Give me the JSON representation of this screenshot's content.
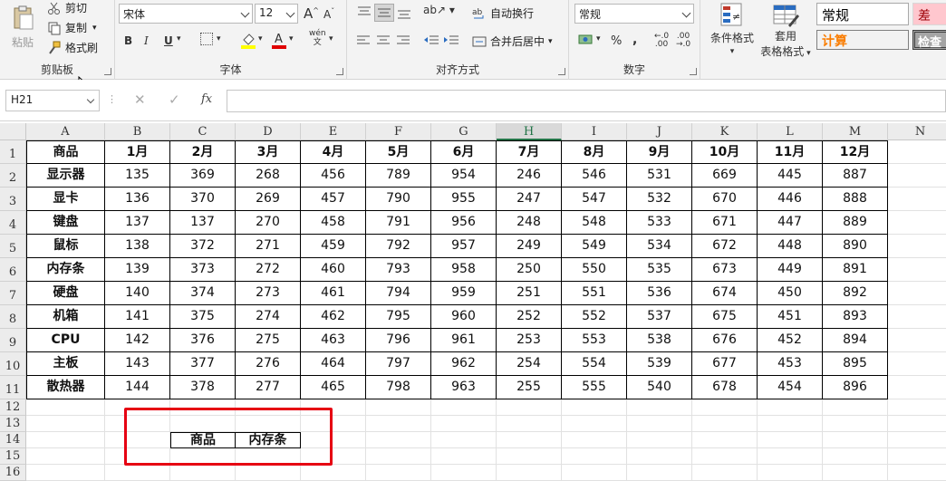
{
  "ribbon": {
    "clipboard": {
      "paste": "粘贴",
      "cut": "剪切",
      "copy": "复制",
      "format_painter": "格式刷",
      "label": "剪贴板"
    },
    "font": {
      "name": "宋体",
      "size": "12",
      "bold": "B",
      "italic": "I",
      "underline": "U",
      "phonetic": "wén",
      "label": "字体"
    },
    "alignment": {
      "wrap": "自动换行",
      "merge": "合并后居中",
      "label": "对齐方式"
    },
    "number": {
      "format": "常规",
      "percent": "%",
      "comma": ",",
      "inc_decimal": ".00",
      "dec_decimal": ".0",
      "label": "数字"
    },
    "styles": {
      "conditional": "条件格式",
      "table_format_1": "套用",
      "table_format_2": "表格格式",
      "normal": "常规",
      "bad": "差",
      "calc": "计算",
      "check": "检查"
    }
  },
  "formula_bar": {
    "name_box": "H21",
    "fx": "fx",
    "value": ""
  },
  "columns": [
    "A",
    "B",
    "C",
    "D",
    "E",
    "F",
    "G",
    "H",
    "I",
    "J",
    "K",
    "L",
    "M",
    "N"
  ],
  "rows": [
    "1",
    "2",
    "3",
    "4",
    "5",
    "6",
    "7",
    "8",
    "9",
    "10",
    "11",
    "12",
    "13",
    "14",
    "15",
    "16"
  ],
  "table": {
    "header": [
      "商品",
      "1月",
      "2月",
      "3月",
      "4月",
      "5月",
      "6月",
      "7月",
      "8月",
      "9月",
      "10月",
      "11月",
      "12月"
    ],
    "body": [
      [
        "显示器",
        "135",
        "369",
        "268",
        "456",
        "789",
        "954",
        "246",
        "546",
        "531",
        "669",
        "445",
        "887"
      ],
      [
        "显卡",
        "136",
        "370",
        "269",
        "457",
        "790",
        "955",
        "247",
        "547",
        "532",
        "670",
        "446",
        "888"
      ],
      [
        "键盘",
        "137",
        "137",
        "270",
        "458",
        "791",
        "956",
        "248",
        "548",
        "533",
        "671",
        "447",
        "889"
      ],
      [
        "鼠标",
        "138",
        "372",
        "271",
        "459",
        "792",
        "957",
        "249",
        "549",
        "534",
        "672",
        "448",
        "890"
      ],
      [
        "内存条",
        "139",
        "373",
        "272",
        "460",
        "793",
        "958",
        "250",
        "550",
        "535",
        "673",
        "449",
        "891"
      ],
      [
        "硬盘",
        "140",
        "374",
        "273",
        "461",
        "794",
        "959",
        "251",
        "551",
        "536",
        "674",
        "450",
        "892"
      ],
      [
        "机箱",
        "141",
        "375",
        "274",
        "462",
        "795",
        "960",
        "252",
        "552",
        "537",
        "675",
        "451",
        "893"
      ],
      [
        "CPU",
        "142",
        "376",
        "275",
        "463",
        "796",
        "961",
        "253",
        "553",
        "538",
        "676",
        "452",
        "894"
      ],
      [
        "主板",
        "143",
        "377",
        "276",
        "464",
        "797",
        "962",
        "254",
        "554",
        "539",
        "677",
        "453",
        "895"
      ],
      [
        "散热器",
        "144",
        "378",
        "277",
        "465",
        "798",
        "963",
        "255",
        "555",
        "540",
        "678",
        "454",
        "896"
      ]
    ]
  },
  "lookup": {
    "label": "商品",
    "value": "内存条"
  },
  "colors": {
    "highlight": "#e60012",
    "selected_col": "#217346"
  }
}
